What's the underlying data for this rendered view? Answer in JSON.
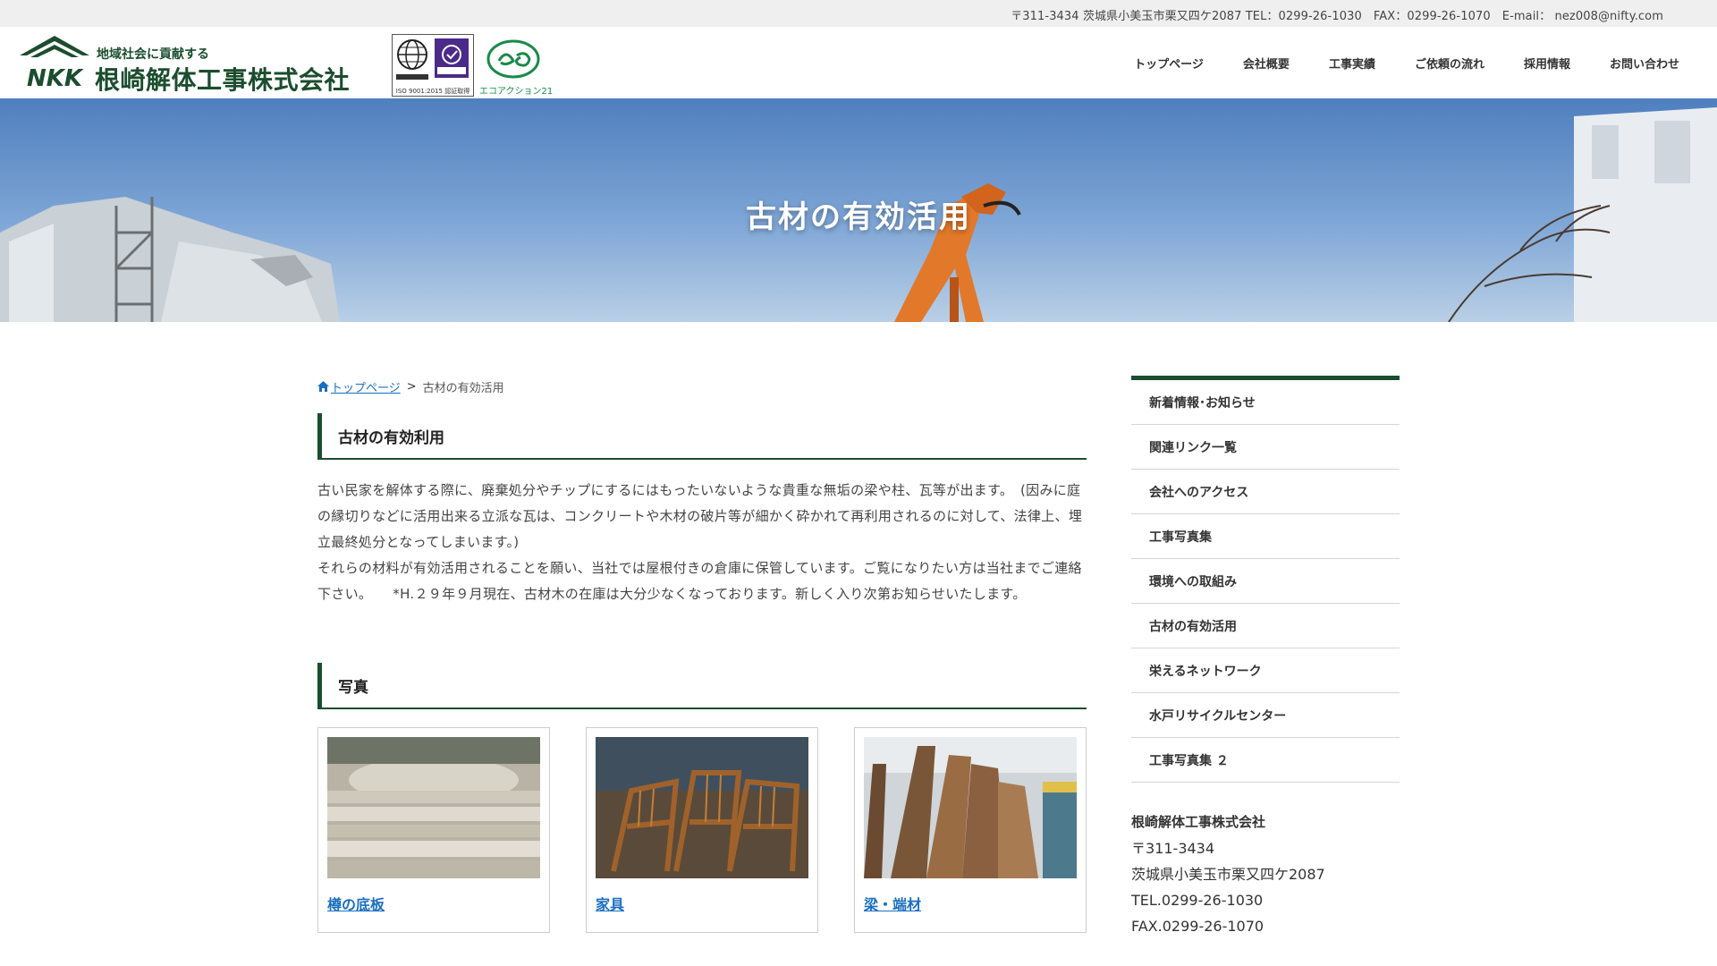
{
  "topbar": {
    "contact": "〒311-3434 茨城県小美玉市栗又四ケ2087 TEL：0299-26-1030　FAX：0299-26-1070　E-mail： nez008@nifty.com"
  },
  "header": {
    "logo_mark": "NKK",
    "tagline": "地域社会に貢献する",
    "company_name": "根崎解体工事株式会社",
    "cert_iso_caption": "ISO 9001:2015 認証取得",
    "cert_ea_caption": "エコアクション21",
    "nav": [
      {
        "label": "トップページ"
      },
      {
        "label": "会社概要"
      },
      {
        "label": "工事実績"
      },
      {
        "label": "ご依頼の流れ"
      },
      {
        "label": "採用情報"
      },
      {
        "label": "お問い合わせ"
      }
    ]
  },
  "hero": {
    "title": "古材の有効活用"
  },
  "breadcrumb": {
    "home": "トップページ",
    "separator": ">",
    "current": "古材の有効活用"
  },
  "main": {
    "heading1": "古材の有効利用",
    "paragraph1": "古い民家を解体する際に、廃棄処分やチップにするにはもったいないような貴重な無垢の梁や柱、瓦等が出ます。　(因みに庭の縁切りなどに活用出来る立派な瓦は、コンクリートや木材の破片等が細かく砕かれて再利用されるのに対して、法律上、埋立最終処分となってしまいます。)",
    "paragraph2": "それらの材料が有効活用されることを願い、当社では屋根付きの倉庫に保管しています。ご覧になりたい方は当社までご連絡下さい。　　*H.２９年９月現在、古材木の在庫は大分少なくなっております。新しく入り次第お知らせいたします。",
    "heading2": "写真",
    "gallery": [
      {
        "caption": "樽の底板"
      },
      {
        "caption": "家具"
      },
      {
        "caption": "梁・端材"
      }
    ]
  },
  "sidebar": {
    "menu": [
      {
        "label": "新着情報･お知らせ"
      },
      {
        "label": "関連リンク一覧"
      },
      {
        "label": "会社へのアクセス"
      },
      {
        "label": "工事写真集"
      },
      {
        "label": "環境への取組み"
      },
      {
        "label": "古材の有効活用"
      },
      {
        "label": "栄えるネットワーク"
      },
      {
        "label": "水戸リサイクルセンター"
      },
      {
        "label": "工事写真集 ２"
      }
    ],
    "company": {
      "name": "根崎解体工事株式会社",
      "postal": "〒311-3434",
      "address": "茨城県小美玉市栗又四ケ2087",
      "tel": "TEL.0299-26-1030",
      "fax": "FAX.0299-26-1070"
    }
  },
  "colors": {
    "brand_green": "#1b4d2e",
    "link_blue": "#1a6fbf",
    "topbar_bg": "#efefef"
  }
}
